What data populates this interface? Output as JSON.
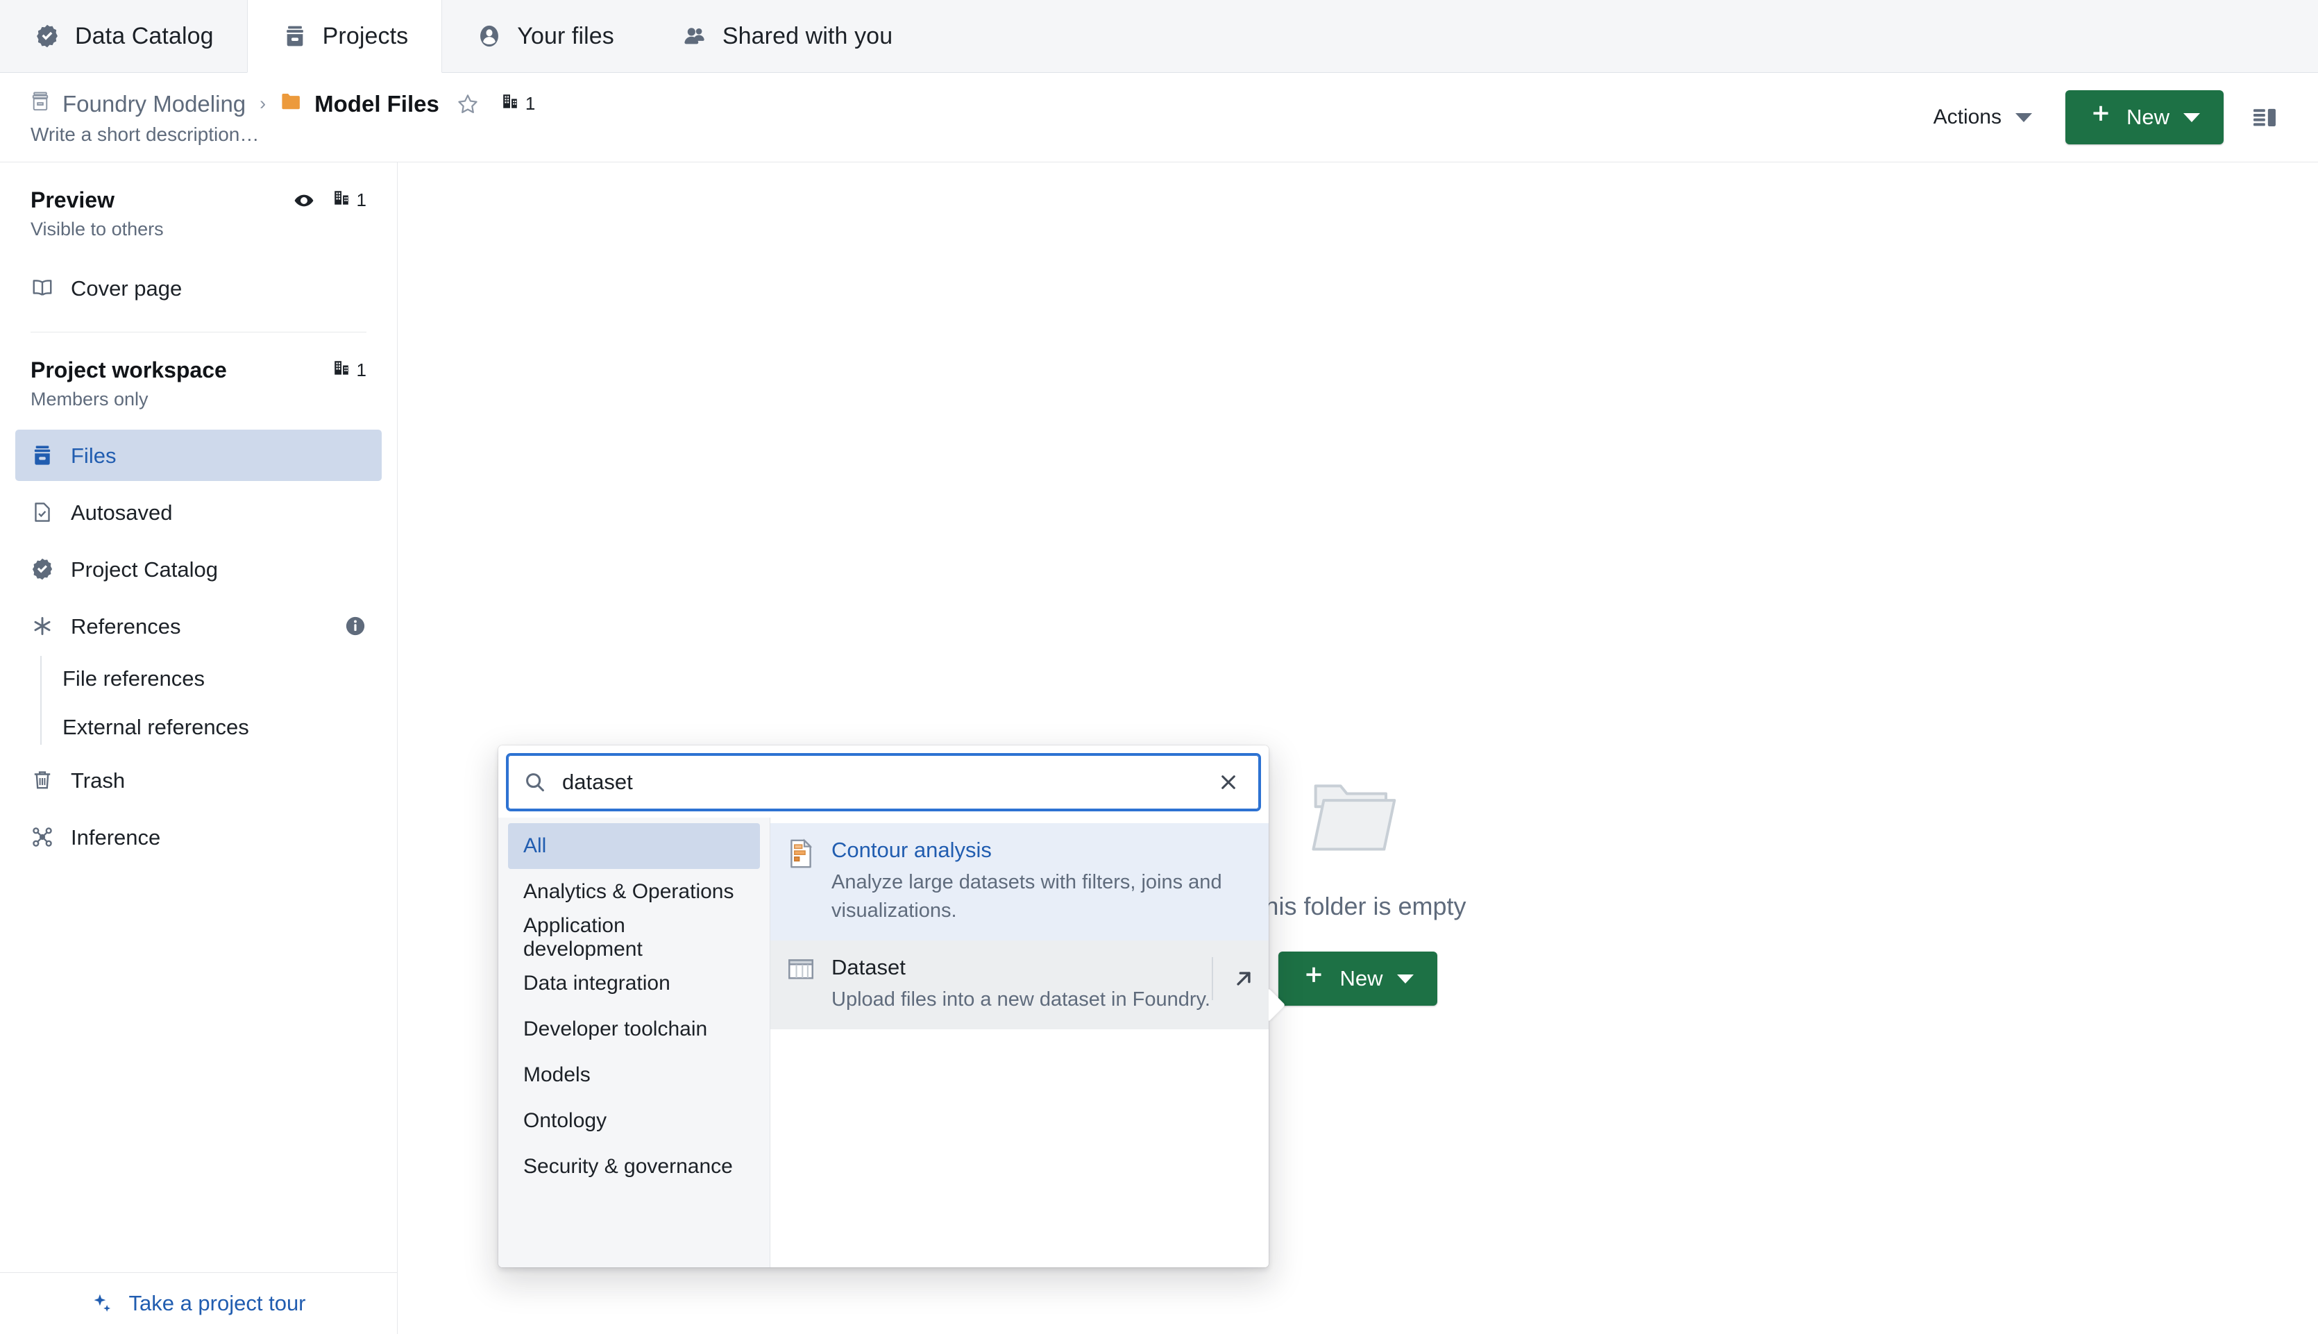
{
  "topnav": {
    "tabs": [
      {
        "label": "Data Catalog",
        "icon": "verified-badge-icon",
        "active": false
      },
      {
        "label": "Projects",
        "icon": "archive-box-icon",
        "active": true
      },
      {
        "label": "Your files",
        "icon": "user-circle-icon",
        "active": false
      },
      {
        "label": "Shared with you",
        "icon": "people-icon",
        "active": false
      }
    ]
  },
  "header": {
    "breadcrumb": {
      "root_label": "Foundry Modeling",
      "root_icon": "archive-box-icon",
      "separator": "›",
      "current_label": "Model Files",
      "current_icon": "folder-icon",
      "star_icon": "star-outline-icon",
      "org_icon": "organization-icon",
      "org_count": "1"
    },
    "description_placeholder": "Write a short description…",
    "actions_label": "Actions",
    "new_label": "New",
    "plus_icon": "plus-icon",
    "caret_icon": "chevron-down-icon",
    "panel_toggle_icon": "right-panel-toggle-icon"
  },
  "sidebar": {
    "preview": {
      "title": "Preview",
      "subtitle": "Visible to others",
      "eye_icon": "eye-icon",
      "org_icon": "organization-icon",
      "org_count": "1"
    },
    "preview_items": [
      {
        "label": "Cover page",
        "icon": "book-open-icon"
      }
    ],
    "workspace": {
      "title": "Project workspace",
      "subtitle": "Members only",
      "org_icon": "organization-icon",
      "org_count": "1"
    },
    "items": [
      {
        "label": "Files",
        "icon": "archive-box-icon",
        "selected": true
      },
      {
        "label": "Autosaved",
        "icon": "document-check-icon",
        "selected": false
      },
      {
        "label": "Project Catalog",
        "icon": "verified-badge-icon",
        "selected": false
      },
      {
        "label": "References",
        "icon": "asterisk-icon",
        "selected": false,
        "info_icon": "info-icon"
      }
    ],
    "sub_items": [
      {
        "label": "File references"
      },
      {
        "label": "External references"
      }
    ],
    "items_after": [
      {
        "label": "Trash",
        "icon": "trash-icon",
        "selected": false
      },
      {
        "label": "Inference",
        "icon": "graph-nodes-icon",
        "selected": false
      }
    ],
    "footer": {
      "tour_label": "Take a project tour",
      "tour_icon": "sparkles-icon"
    }
  },
  "main": {
    "empty_state": {
      "folder_icon": "empty-folder-icon",
      "title": "This folder is empty",
      "new_label": "New",
      "plus_icon": "plus-icon",
      "caret_icon": "chevron-down-icon"
    }
  },
  "popover": {
    "search": {
      "value": "dataset",
      "placeholder": "Search",
      "search_icon": "search-icon",
      "clear_icon": "close-icon"
    },
    "categories": [
      {
        "label": "All",
        "active": true
      },
      {
        "label": "Analytics & Operations",
        "active": false
      },
      {
        "label": "Application development",
        "active": false
      },
      {
        "label": "Data integration",
        "active": false
      },
      {
        "label": "Developer toolchain",
        "active": false
      },
      {
        "label": "Models",
        "active": false
      },
      {
        "label": "Ontology",
        "active": false
      },
      {
        "label": "Security & governance",
        "active": false
      }
    ],
    "results": [
      {
        "title": "Contour analysis",
        "description": "Analyze large datasets with filters, joins and visualizations.",
        "icon": "contour-document-icon",
        "state": "highlighted",
        "open_icon": null
      },
      {
        "title": "Dataset",
        "description": "Upload files into a new dataset in Foundry.",
        "icon": "dataset-table-icon",
        "state": "hover",
        "open_icon": "open-external-icon"
      }
    ]
  },
  "colors": {
    "accent_blue": "#215db0",
    "focus_blue": "#2d72d2",
    "selection_blue": "#ced9eb",
    "highlight_blue": "#e8eef8",
    "green": "#1d7145",
    "gray_text": "#5f6b7c",
    "dark_text": "#1c2127",
    "folder_yellow": "#ec9a3c",
    "orange": "#ec9a3c"
  }
}
